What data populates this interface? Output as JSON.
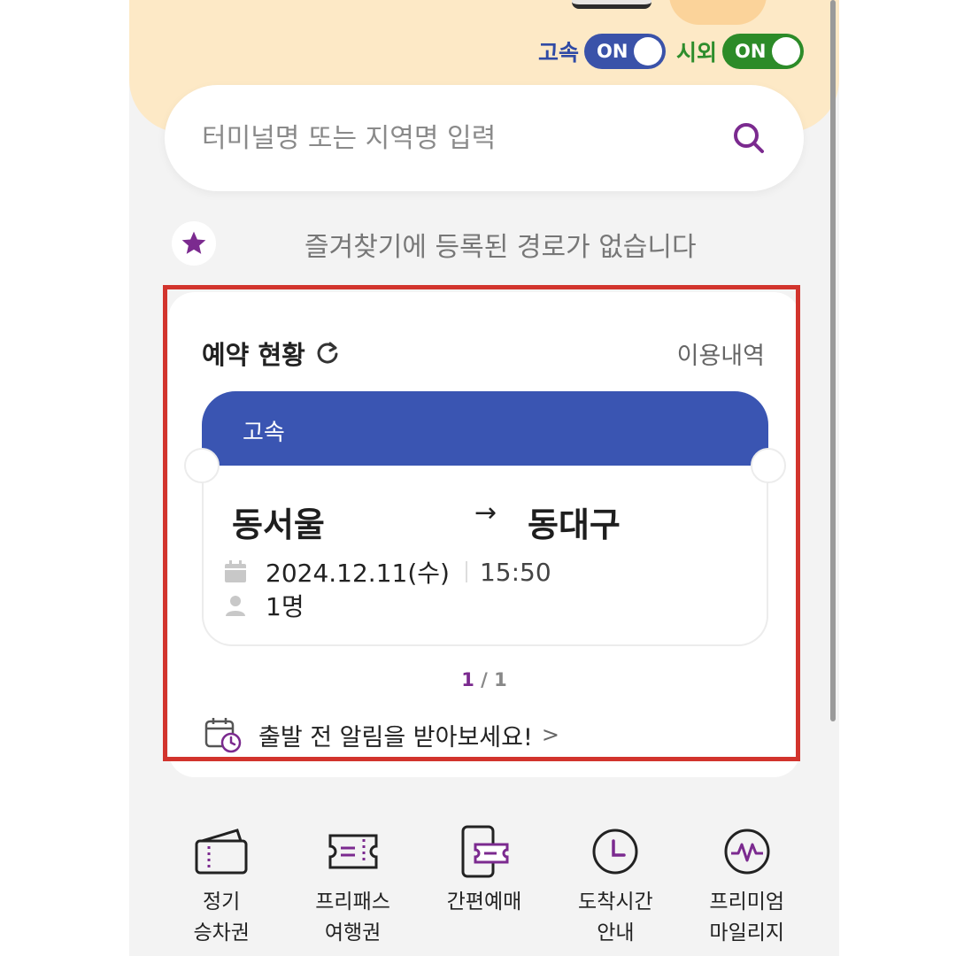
{
  "toggles": {
    "express_label": "고속",
    "express_state": "ON",
    "intercity_label": "시외",
    "intercity_state": "ON"
  },
  "search": {
    "placeholder": "터미널명 또는 지역명 입력"
  },
  "favorites": {
    "empty_text": "즐겨찾기에 등록된 경로가 없습니다"
  },
  "reservation": {
    "title": "예약 현황",
    "history_link": "이용내역",
    "ticket": {
      "type": "고속",
      "from": "동서울",
      "to": "동대구",
      "date": "2024.12.11(수)",
      "time": "15:50",
      "passengers": "1명"
    },
    "pager_current": "1",
    "pager_total": "/ 1",
    "alarm_text": "출발 전 알림을 받아보세요!"
  },
  "menu": [
    {
      "label": "정기\n승차권"
    },
    {
      "label": "프리패스\n여행권"
    },
    {
      "label": "간편예매"
    },
    {
      "label": "도착시간\n안내"
    },
    {
      "label": "프리미엄\n마일리지"
    }
  ],
  "colors": {
    "accent_purple": "#7b2a8f",
    "express_blue": "#3a55b2",
    "intercity_green": "#2c8b28",
    "highlight_red": "#d2342d"
  }
}
